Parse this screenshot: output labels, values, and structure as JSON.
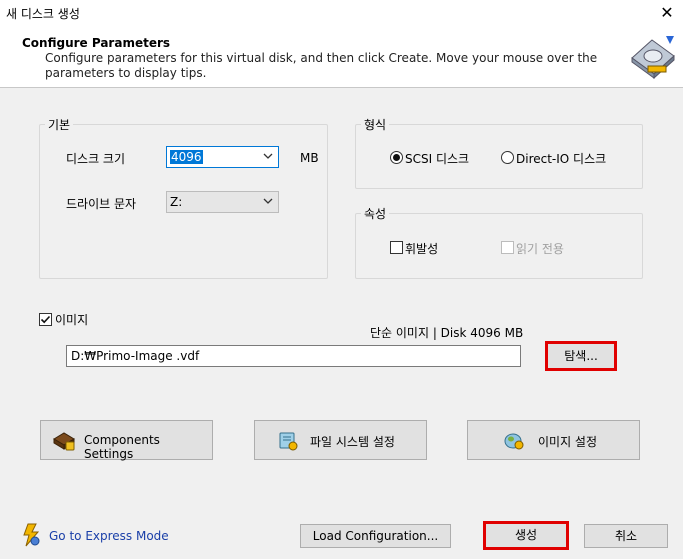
{
  "window": {
    "title": "새 디스크 생성",
    "close_glyph": "✕"
  },
  "header": {
    "title": "Configure Parameters",
    "description": "Configure parameters for this virtual disk, and then click Create. Move your mouse over the parameters to display tips."
  },
  "basic": {
    "group_label": "기본",
    "disk_size_label": "디스크 크기",
    "disk_size_value": "4096",
    "disk_size_unit": "MB",
    "drive_letter_label": "드라이브 문자",
    "drive_letter_value": "Z:"
  },
  "format": {
    "group_label": "형식",
    "options": [
      {
        "label": "SCSI 디스크",
        "selected": true
      },
      {
        "label": "Direct-IO 디스크",
        "selected": false
      }
    ]
  },
  "attributes": {
    "group_label": "속성",
    "volatile_label": "휘발성",
    "volatile_checked": false,
    "readonly_label": "읽기 전용",
    "readonly_checked": false,
    "readonly_enabled": false
  },
  "image": {
    "checkbox_label": "이미지",
    "checked": true,
    "info": "단순 이미지 | Disk 4096 MB",
    "path_value": "D:₩Primo-Image          .vdf",
    "browse_label": "탐색..."
  },
  "action_buttons": {
    "components_settings": "Components Settings",
    "filesystem_settings": "파일 시스템 설정",
    "image_settings": "이미지 설정"
  },
  "footer": {
    "express_mode_link": "Go to Express Mode",
    "load_configuration": "Load Configuration...",
    "create": "생성",
    "cancel": "취소"
  },
  "colors": {
    "highlight_red": "#e00000",
    "selection_blue": "#0078d7",
    "link_blue": "#1a3fa8"
  },
  "icons": [
    "disk-wizard-icon",
    "chevron-down-icon",
    "components-icon",
    "filesystem-icon",
    "image-settings-icon",
    "lightning-icon"
  ]
}
